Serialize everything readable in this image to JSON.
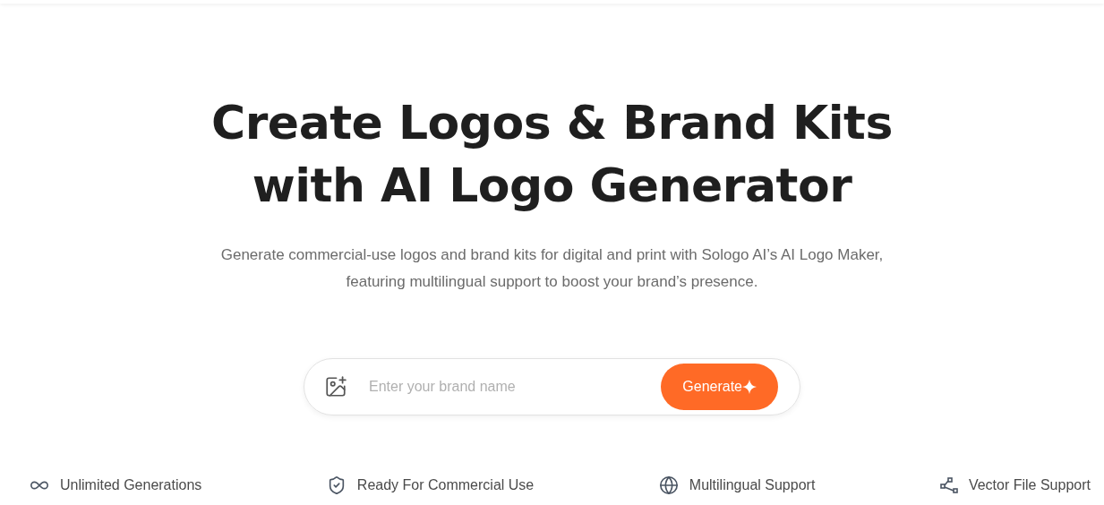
{
  "hero": {
    "title_lines": [
      "Create Logos & Brand Kits",
      "with AI Logo Generator"
    ],
    "subtitle": "Generate commercial-use logos and brand kits for digital and print with Sologo AI’s AI Logo Maker, featuring multilingual support to boost your brand’s presence."
  },
  "search": {
    "placeholder": "Enter your brand name",
    "button": "Generate"
  },
  "features": [
    {
      "kind": "infinity",
      "label": "Unlimited Generations"
    },
    {
      "kind": "shield",
      "label": "Ready For Commercial Use"
    },
    {
      "kind": "globe",
      "label": "Multilingual Support"
    },
    {
      "kind": "vector",
      "label": "Vector File Support"
    }
  ]
}
